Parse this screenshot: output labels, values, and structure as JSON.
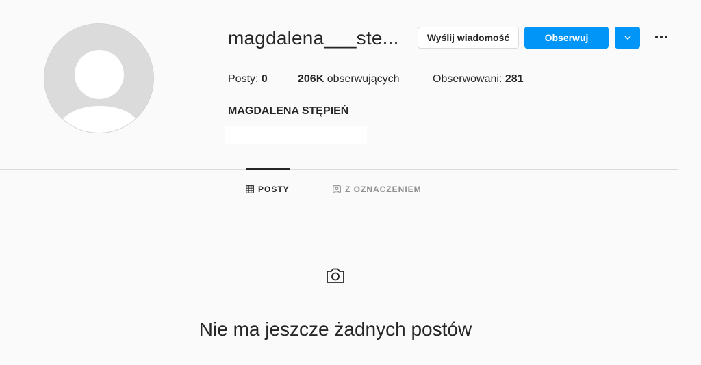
{
  "profile": {
    "username": "magdalena___ste...",
    "full_name": "MAGDALENA STĘPIEŃ",
    "avatar": "default-avatar"
  },
  "actions": {
    "message_label": "Wyślij wiadomość",
    "follow_label": "Obserwuj",
    "dropdown_icon": "chevron-down-icon",
    "more_icon": "more-options-icon"
  },
  "stats": {
    "posts_label": "Posty:",
    "posts_value": "0",
    "followers_value": "206K",
    "followers_label": "obserwujących",
    "following_label": "Obserwowani:",
    "following_value": "281"
  },
  "tabs": [
    {
      "label": "POSTY",
      "icon": "grid-icon",
      "active": true
    },
    {
      "label": "Z OZNACZENIEM",
      "icon": "tagged-icon",
      "active": false
    }
  ],
  "empty_state": {
    "icon": "camera-icon",
    "message": "Nie ma jeszcze żadnych postów"
  },
  "colors": {
    "background": "#fafafa",
    "accent": "#0095f6",
    "text": "#262626",
    "muted": "#8e8e8e",
    "border": "#dbdbdb"
  }
}
